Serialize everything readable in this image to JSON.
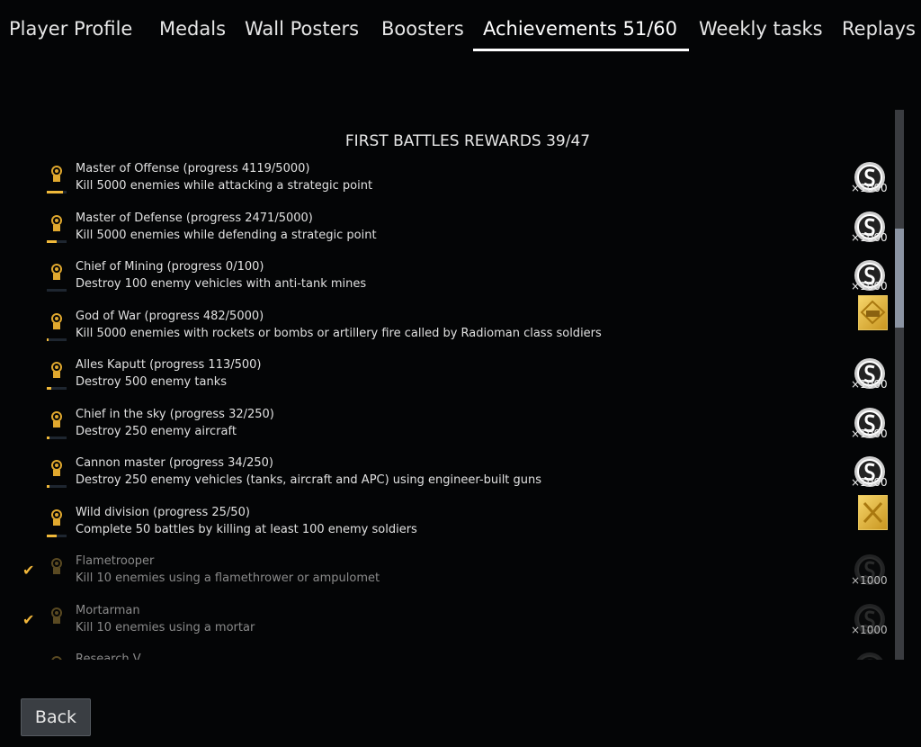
{
  "tabs": [
    {
      "label": "Player Profile",
      "active": false
    },
    {
      "label": "Medals",
      "active": false
    },
    {
      "label": "Wall Posters",
      "active": false
    },
    {
      "label": "Boosters",
      "active": false
    },
    {
      "label": "Achievements 51/60",
      "active": true
    },
    {
      "label": "Weekly tasks",
      "active": false
    },
    {
      "label": "Replays",
      "active": false
    }
  ],
  "section_title": "FIRST BATTLES REWARDS 39/47",
  "colors": {
    "accent": "#f0b93a",
    "scroll_thumb": "#8b94a3"
  },
  "achievements": [
    {
      "title": "Master of Offense (progress 4119/5000)",
      "desc": "Kill 5000 enemies while attacking a strategic point",
      "progress": 0.82,
      "reward": "silver-coin",
      "mult": "×1000",
      "done": false
    },
    {
      "title": "Master of Defense (progress 2471/5000)",
      "desc": "Kill 5000 enemies while defending a strategic point",
      "progress": 0.49,
      "reward": "silver-coin",
      "mult": "×1000",
      "done": false
    },
    {
      "title": "Chief of Mining (progress 0/100)",
      "desc": "Destroy 100 enemy vehicles with anti-tank mines",
      "progress": 0,
      "reward": "silver-coin",
      "mult": "×1000",
      "done": false
    },
    {
      "title": "God of War (progress 482/5000)",
      "desc": "Kill 5000 enemies with rockets or bombs or artillery fire called by Radioman class soldiers",
      "progress": 0.1,
      "reward": "gold-tank-decal",
      "done": false
    },
    {
      "title": "Alles Kaputt (progress 113/500)",
      "desc": "Destroy 500 enemy tanks",
      "progress": 0.23,
      "reward": "silver-coin",
      "mult": "×1000",
      "done": false
    },
    {
      "title": "Chief in the sky (progress 32/250)",
      "desc": "Destroy 250 enemy aircraft",
      "progress": 0.13,
      "reward": "silver-coin",
      "mult": "×1000",
      "done": false
    },
    {
      "title": "Cannon master (progress 34/250)",
      "desc": "Destroy 250 enemy vehicles (tanks, aircraft and APC) using engineer-built guns",
      "progress": 0.14,
      "reward": "silver-coin",
      "mult": "×1000",
      "done": false
    },
    {
      "title": "Wild division (progress 25/50)",
      "desc": "Complete 50 battles by killing at least 100 enemy soldiers",
      "progress": 0.5,
      "reward": "gold-crossed-swords",
      "done": false
    },
    {
      "title": "Flametrooper",
      "desc": "Kill 10 enemies using a flamethrower or ampulomet",
      "reward": "silver-coin",
      "mult": "×1000",
      "done": true
    },
    {
      "title": "Mortarman",
      "desc": "Kill 10 enemies using a mortar",
      "reward": "silver-coin",
      "mult": "×1000",
      "done": true
    },
    {
      "title": "Research V",
      "desc": "",
      "reward": "silver-coin",
      "done": true
    }
  ],
  "back_label": "Back"
}
